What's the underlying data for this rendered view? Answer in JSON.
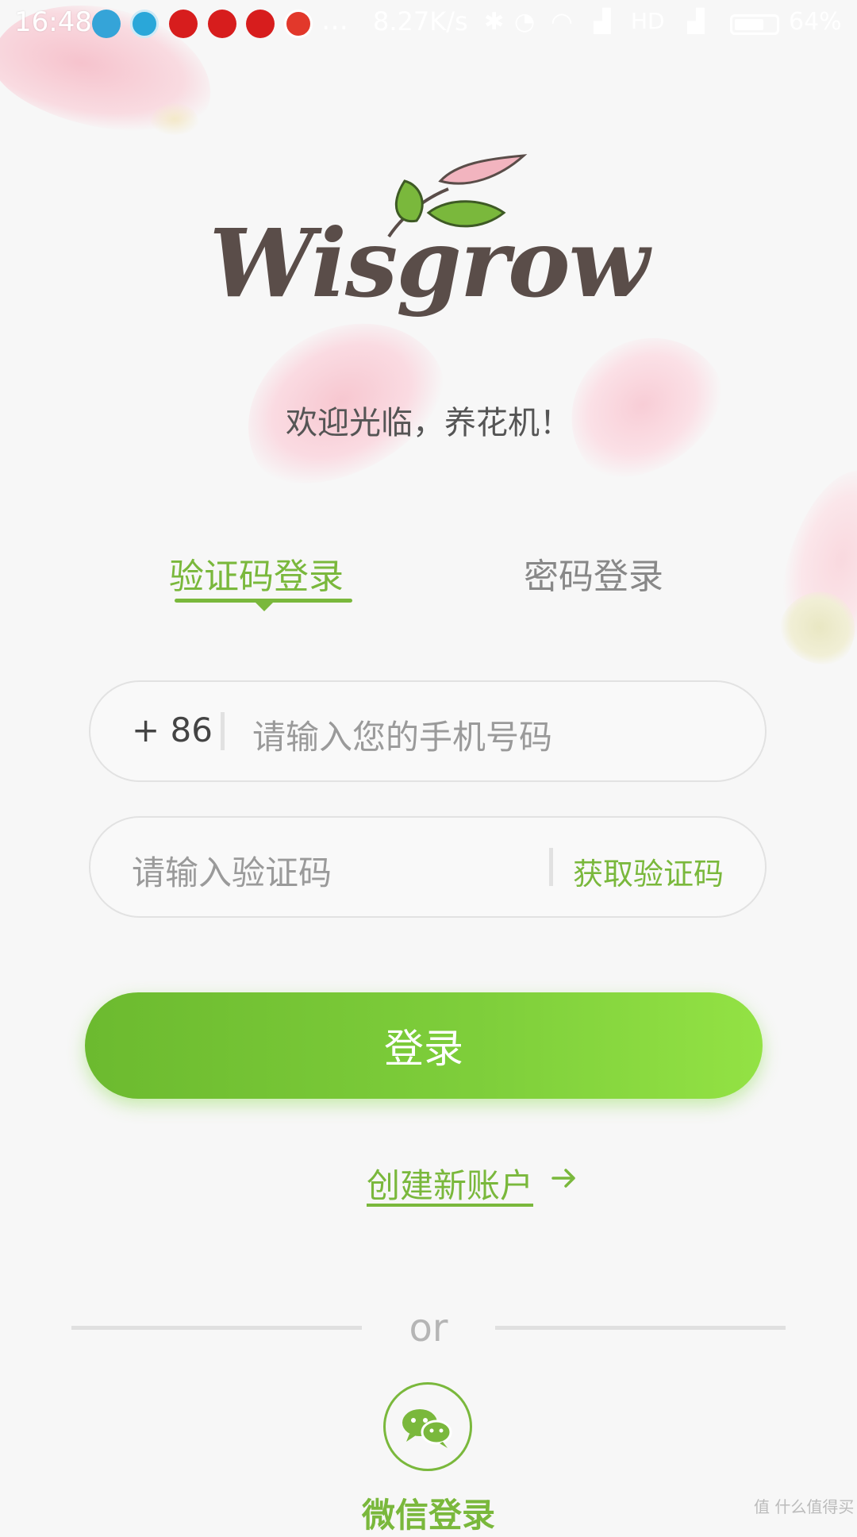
{
  "status_bar": {
    "time": "16:48",
    "network_speed": "8.27K/s",
    "battery": "64%",
    "icons": [
      "alipay-icon",
      "browser-icon",
      "netease-icon",
      "netease-icon",
      "netease-icon",
      "app-icon",
      "more-icon",
      "bluetooth-icon",
      "alarm-icon",
      "wifi-icon",
      "signal-icon",
      "hd-icon",
      "signal-icon",
      "battery-icon"
    ]
  },
  "brand": {
    "logo_text": "Wisgrow",
    "welcome": "欢迎光临，养花机！"
  },
  "tabs": [
    {
      "label": "验证码登录",
      "active": true
    },
    {
      "label": "密码登录",
      "active": false
    }
  ],
  "phone_field": {
    "country_code": "+ 86",
    "placeholder": "请输入您的手机号码",
    "value": ""
  },
  "code_field": {
    "placeholder": "请输入验证码",
    "value": "",
    "get_code_label": "获取验证码"
  },
  "login_button": {
    "label": "登录"
  },
  "create_account": {
    "label": "创建新账户"
  },
  "divider": {
    "label": "or"
  },
  "wechat_login": {
    "label": "微信登录"
  },
  "watermark": {
    "text": "值 什么值得买"
  },
  "colors": {
    "accent": "#7ab83c",
    "button_start": "#6cba2f",
    "button_end": "#93e244",
    "background": "#f7f7f7"
  }
}
